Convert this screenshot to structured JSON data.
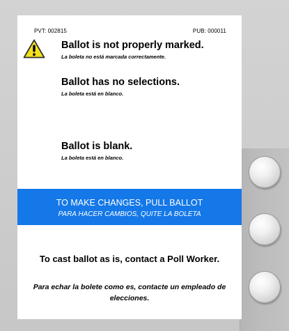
{
  "meta": {
    "pvt": "PVT:  002815",
    "pub": "PUB:  000011"
  },
  "messages": [
    {
      "title": "Ballot is not properly marked.",
      "subtitle": "La boleta no está marcada correctamente."
    },
    {
      "title": "Ballot has no selections.",
      "subtitle": "La boleta está en blanco."
    },
    {
      "title": "Ballot is blank.",
      "subtitle": "La boleta está en blanco."
    }
  ],
  "banner": {
    "main": "TO MAKE CHANGES, PULL BALLOT",
    "sub": "PARA HACER CAMBIOS, QUITE LA BOLETA",
    "color": "#1478e8"
  },
  "cast": {
    "main": "To cast ballot as is, contact a Poll Worker.",
    "sub": "Para echar la bolete como es, contacte un empleado de elecciones."
  },
  "icons": {
    "warning": "warning-icon"
  }
}
